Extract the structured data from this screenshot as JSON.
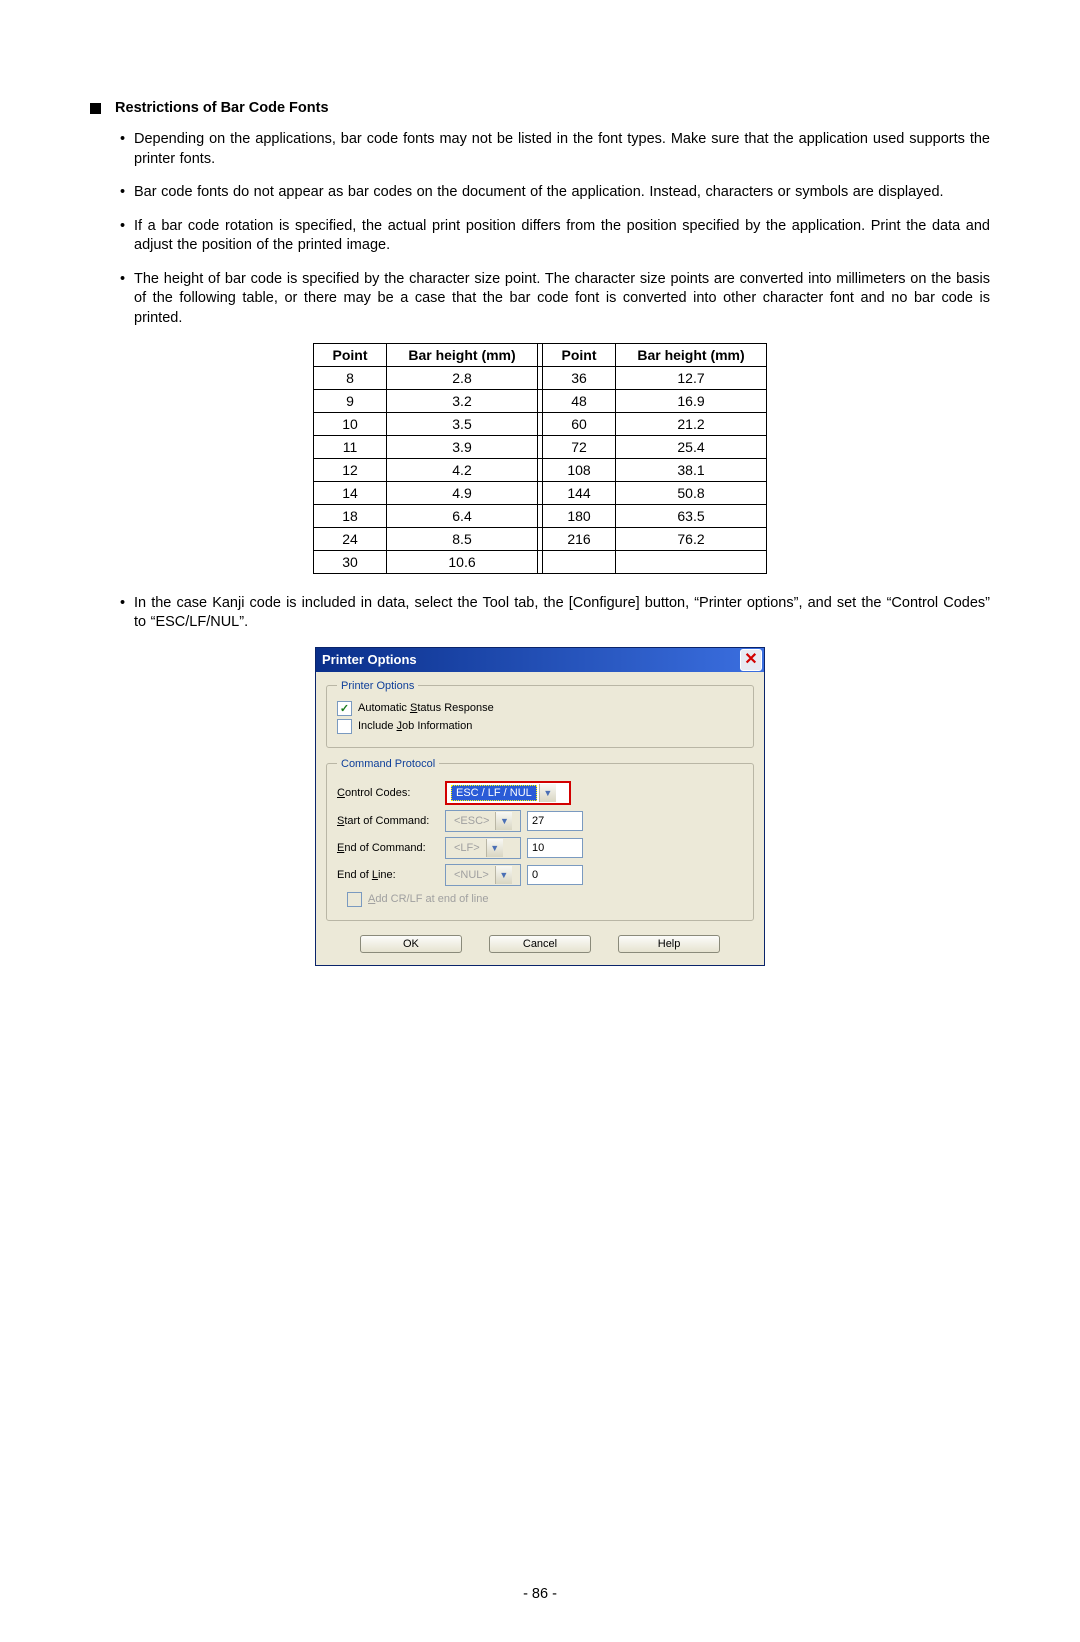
{
  "section_heading": "Restrictions of Bar Code Fonts",
  "bullets": {
    "b1": "Depending on the applications, bar code fonts may not be listed in the font types.   Make sure that the application used supports the printer fonts.",
    "b2": "Bar code fonts do not appear as bar codes on the document of the application.   Instead, characters or symbols are displayed.",
    "b3": "If a bar code rotation is specified, the actual print position differs from the position specified by the application.   Print the data and adjust the position of the printed image.",
    "b4": "The height of bar code is specified by the character size point.   The character size points are converted into millimeters on the basis of the following table, or there may be a case that the bar code font is converted into other character font and no bar code is printed."
  },
  "table": {
    "headers": {
      "point": "Point",
      "height": "Bar height (mm)"
    },
    "left": [
      {
        "p": "8",
        "h": "2.8"
      },
      {
        "p": "9",
        "h": "3.2"
      },
      {
        "p": "10",
        "h": "3.5"
      },
      {
        "p": "11",
        "h": "3.9"
      },
      {
        "p": "12",
        "h": "4.2"
      },
      {
        "p": "14",
        "h": "4.9"
      },
      {
        "p": "18",
        "h": "6.4"
      },
      {
        "p": "24",
        "h": "8.5"
      },
      {
        "p": "30",
        "h": "10.6"
      }
    ],
    "right": [
      {
        "p": "36",
        "h": "12.7"
      },
      {
        "p": "48",
        "h": "16.9"
      },
      {
        "p": "60",
        "h": "21.2"
      },
      {
        "p": "72",
        "h": "25.4"
      },
      {
        "p": "108",
        "h": "38.1"
      },
      {
        "p": "144",
        "h": "50.8"
      },
      {
        "p": "180",
        "h": "63.5"
      },
      {
        "p": "216",
        "h": "76.2"
      },
      {
        "p": "",
        "h": ""
      }
    ]
  },
  "bullet5": "In the case Kanji code is included in data, select the Tool tab, the [Configure] button, “Printer options”, and set the “Control Codes” to “ESC/LF/NUL”.",
  "dialog": {
    "title": "Printer Options",
    "group1": "Printer Options",
    "cb1_pre": "Automatic ",
    "cb1_u": "S",
    "cb1_post": "tatus Response",
    "cb2_pre": "Include ",
    "cb2_u": "J",
    "cb2_post": "ob Information",
    "group2": "Command Protocol",
    "lbl_cc_u": "C",
    "lbl_cc_post": "ontrol Codes:",
    "cc_value": "ESC / LF / NUL",
    "lbl_soc_u": "S",
    "lbl_soc_post": "tart of Command:",
    "soc_combo": "<ESC>",
    "soc_num": "27",
    "lbl_eoc_u": "E",
    "lbl_eoc_post": "nd of Command:",
    "eoc_combo": "<LF>",
    "eoc_num": "10",
    "lbl_eol_pre": "End of ",
    "lbl_eol_u": "L",
    "lbl_eol_post": "ine:",
    "eol_combo": "<NUL>",
    "eol_num": "0",
    "cb3_u": "A",
    "cb3_post": "dd CR/LF at end of line",
    "ok": "OK",
    "cancel": "Cancel",
    "help": "Help"
  },
  "page_number": "- 86 -"
}
